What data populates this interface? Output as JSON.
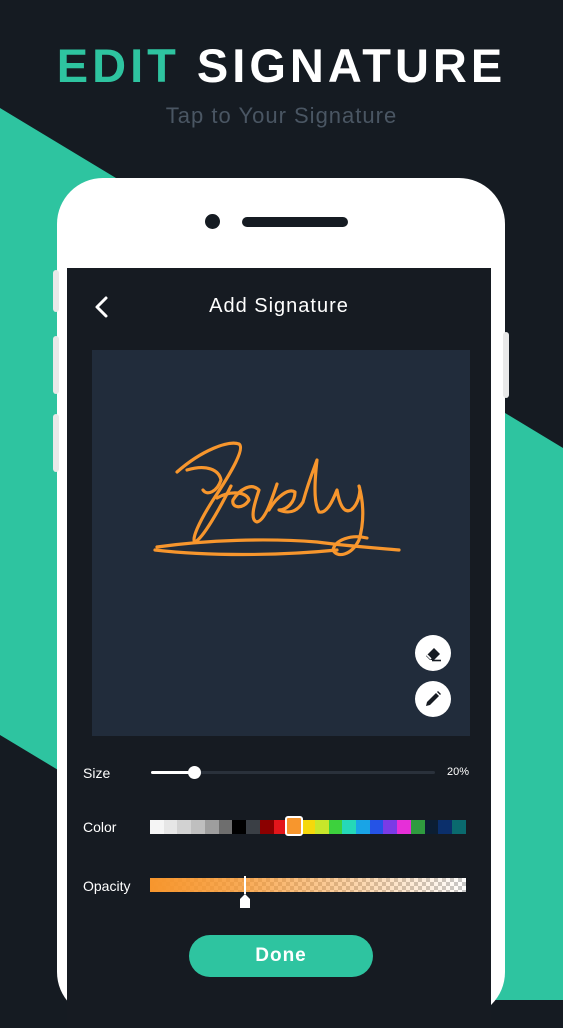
{
  "promo": {
    "headline_accent": "EDIT",
    "headline_rest": "SIGNATURE",
    "subtitle": "Tap to Your Signature",
    "accent_color": "#2ec4a0",
    "background_color": "#151b22"
  },
  "screen": {
    "title": "Add Signature",
    "back_icon": "chevron-left-icon",
    "signature_color": "#f7962d",
    "tools": [
      {
        "name": "eraser",
        "icon": "eraser-icon"
      },
      {
        "name": "pen",
        "icon": "pencil-icon"
      }
    ]
  },
  "controls": {
    "size": {
      "label": "Size",
      "value_text": "20%",
      "value": 0.15
    },
    "color": {
      "label": "Color",
      "selected_index": 10,
      "swatches": [
        "#f5f5f5",
        "#e6e6e6",
        "#d2d2d2",
        "#bfbfbf",
        "#9e9e9e",
        "#6e6e6e",
        "#000000",
        "#3a3f45",
        "#8b0000",
        "#e3161b",
        "#f7962d",
        "#f5d80b",
        "#c8e62a",
        "#3dd13d",
        "#25d8b8",
        "#19a4e6",
        "#2553e6",
        "#7a3be6",
        "#e62fd8",
        "#2f9b3f",
        "#0c1e33",
        "#0b2f6b",
        "#0a6a6e"
      ]
    },
    "opacity": {
      "label": "Opacity",
      "value": 0.3
    }
  },
  "actions": {
    "done_label": "Done"
  }
}
